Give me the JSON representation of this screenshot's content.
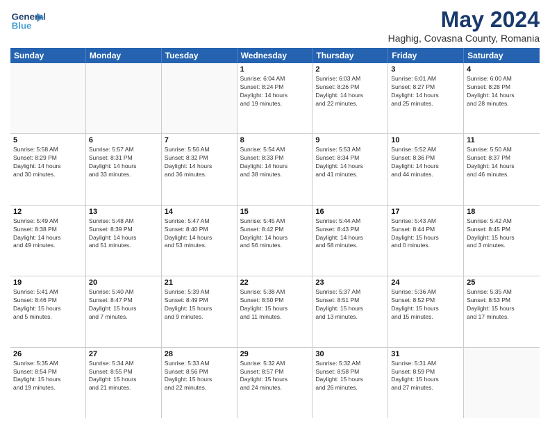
{
  "header": {
    "logo_line1": "General",
    "logo_line2": "Blue",
    "main_title": "May 2024",
    "subtitle": "Haghig, Covasna County, Romania"
  },
  "days_of_week": [
    "Sunday",
    "Monday",
    "Tuesday",
    "Wednesday",
    "Thursday",
    "Friday",
    "Saturday"
  ],
  "weeks": [
    [
      {
        "day": "",
        "info": ""
      },
      {
        "day": "",
        "info": ""
      },
      {
        "day": "",
        "info": ""
      },
      {
        "day": "1",
        "info": "Sunrise: 6:04 AM\nSunset: 8:24 PM\nDaylight: 14 hours\nand 19 minutes."
      },
      {
        "day": "2",
        "info": "Sunrise: 6:03 AM\nSunset: 8:26 PM\nDaylight: 14 hours\nand 22 minutes."
      },
      {
        "day": "3",
        "info": "Sunrise: 6:01 AM\nSunset: 8:27 PM\nDaylight: 14 hours\nand 25 minutes."
      },
      {
        "day": "4",
        "info": "Sunrise: 6:00 AM\nSunset: 8:28 PM\nDaylight: 14 hours\nand 28 minutes."
      }
    ],
    [
      {
        "day": "5",
        "info": "Sunrise: 5:58 AM\nSunset: 8:29 PM\nDaylight: 14 hours\nand 30 minutes."
      },
      {
        "day": "6",
        "info": "Sunrise: 5:57 AM\nSunset: 8:31 PM\nDaylight: 14 hours\nand 33 minutes."
      },
      {
        "day": "7",
        "info": "Sunrise: 5:56 AM\nSunset: 8:32 PM\nDaylight: 14 hours\nand 36 minutes."
      },
      {
        "day": "8",
        "info": "Sunrise: 5:54 AM\nSunset: 8:33 PM\nDaylight: 14 hours\nand 38 minutes."
      },
      {
        "day": "9",
        "info": "Sunrise: 5:53 AM\nSunset: 8:34 PM\nDaylight: 14 hours\nand 41 minutes."
      },
      {
        "day": "10",
        "info": "Sunrise: 5:52 AM\nSunset: 8:36 PM\nDaylight: 14 hours\nand 44 minutes."
      },
      {
        "day": "11",
        "info": "Sunrise: 5:50 AM\nSunset: 8:37 PM\nDaylight: 14 hours\nand 46 minutes."
      }
    ],
    [
      {
        "day": "12",
        "info": "Sunrise: 5:49 AM\nSunset: 8:38 PM\nDaylight: 14 hours\nand 49 minutes."
      },
      {
        "day": "13",
        "info": "Sunrise: 5:48 AM\nSunset: 8:39 PM\nDaylight: 14 hours\nand 51 minutes."
      },
      {
        "day": "14",
        "info": "Sunrise: 5:47 AM\nSunset: 8:40 PM\nDaylight: 14 hours\nand 53 minutes."
      },
      {
        "day": "15",
        "info": "Sunrise: 5:45 AM\nSunset: 8:42 PM\nDaylight: 14 hours\nand 56 minutes."
      },
      {
        "day": "16",
        "info": "Sunrise: 5:44 AM\nSunset: 8:43 PM\nDaylight: 14 hours\nand 58 minutes."
      },
      {
        "day": "17",
        "info": "Sunrise: 5:43 AM\nSunset: 8:44 PM\nDaylight: 15 hours\nand 0 minutes."
      },
      {
        "day": "18",
        "info": "Sunrise: 5:42 AM\nSunset: 8:45 PM\nDaylight: 15 hours\nand 3 minutes."
      }
    ],
    [
      {
        "day": "19",
        "info": "Sunrise: 5:41 AM\nSunset: 8:46 PM\nDaylight: 15 hours\nand 5 minutes."
      },
      {
        "day": "20",
        "info": "Sunrise: 5:40 AM\nSunset: 8:47 PM\nDaylight: 15 hours\nand 7 minutes."
      },
      {
        "day": "21",
        "info": "Sunrise: 5:39 AM\nSunset: 8:49 PM\nDaylight: 15 hours\nand 9 minutes."
      },
      {
        "day": "22",
        "info": "Sunrise: 5:38 AM\nSunset: 8:50 PM\nDaylight: 15 hours\nand 11 minutes."
      },
      {
        "day": "23",
        "info": "Sunrise: 5:37 AM\nSunset: 8:51 PM\nDaylight: 15 hours\nand 13 minutes."
      },
      {
        "day": "24",
        "info": "Sunrise: 5:36 AM\nSunset: 8:52 PM\nDaylight: 15 hours\nand 15 minutes."
      },
      {
        "day": "25",
        "info": "Sunrise: 5:35 AM\nSunset: 8:53 PM\nDaylight: 15 hours\nand 17 minutes."
      }
    ],
    [
      {
        "day": "26",
        "info": "Sunrise: 5:35 AM\nSunset: 8:54 PM\nDaylight: 15 hours\nand 19 minutes."
      },
      {
        "day": "27",
        "info": "Sunrise: 5:34 AM\nSunset: 8:55 PM\nDaylight: 15 hours\nand 21 minutes."
      },
      {
        "day": "28",
        "info": "Sunrise: 5:33 AM\nSunset: 8:56 PM\nDaylight: 15 hours\nand 22 minutes."
      },
      {
        "day": "29",
        "info": "Sunrise: 5:32 AM\nSunset: 8:57 PM\nDaylight: 15 hours\nand 24 minutes."
      },
      {
        "day": "30",
        "info": "Sunrise: 5:32 AM\nSunset: 8:58 PM\nDaylight: 15 hours\nand 26 minutes."
      },
      {
        "day": "31",
        "info": "Sunrise: 5:31 AM\nSunset: 8:59 PM\nDaylight: 15 hours\nand 27 minutes."
      },
      {
        "day": "",
        "info": ""
      }
    ]
  ]
}
